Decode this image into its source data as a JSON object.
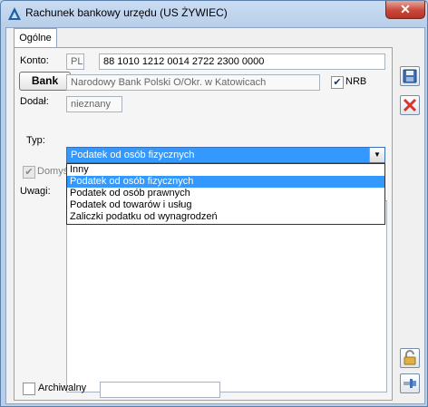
{
  "window": {
    "title": "Rachunek bankowy urzędu (US ŻYWIEC)",
    "close_glyph": "✕"
  },
  "tabs": [
    "Ogólne"
  ],
  "form": {
    "konto_label": "Konto:",
    "konto_prefix": "PL",
    "konto_number": "88 1010 1212 0014 2722 2300 0000",
    "bank_button": "Bank",
    "bank_name": "Narodowy Bank Polski O/Okr. w Katowicach",
    "nrb_label": "NRB",
    "nrb_checked": true,
    "dodal_label": "Dodał:",
    "dodal_value": "nieznany",
    "typ_label": "Typ:",
    "typ_selected": "Podatek od osób fizycznych",
    "typ_options": [
      "Inny",
      "Podatek od osób fizycznych",
      "Podatek od osób prawnych",
      "Podatek od towarów i usług",
      "Zaliczki podatku od wynagrodzeń"
    ],
    "domyslny_label": "Domyś",
    "uwagi_label": "Uwagi:",
    "archiwalny_label": "Archiwalny",
    "archiwalny_value": ""
  },
  "icons": {
    "save": "save-icon",
    "delete": "delete-icon",
    "lock": "lock-icon",
    "pin": "pin-icon"
  },
  "colors": {
    "selection": "#3399ff",
    "window_frame": "#b9cfe9",
    "delete_red": "#d9342b"
  }
}
